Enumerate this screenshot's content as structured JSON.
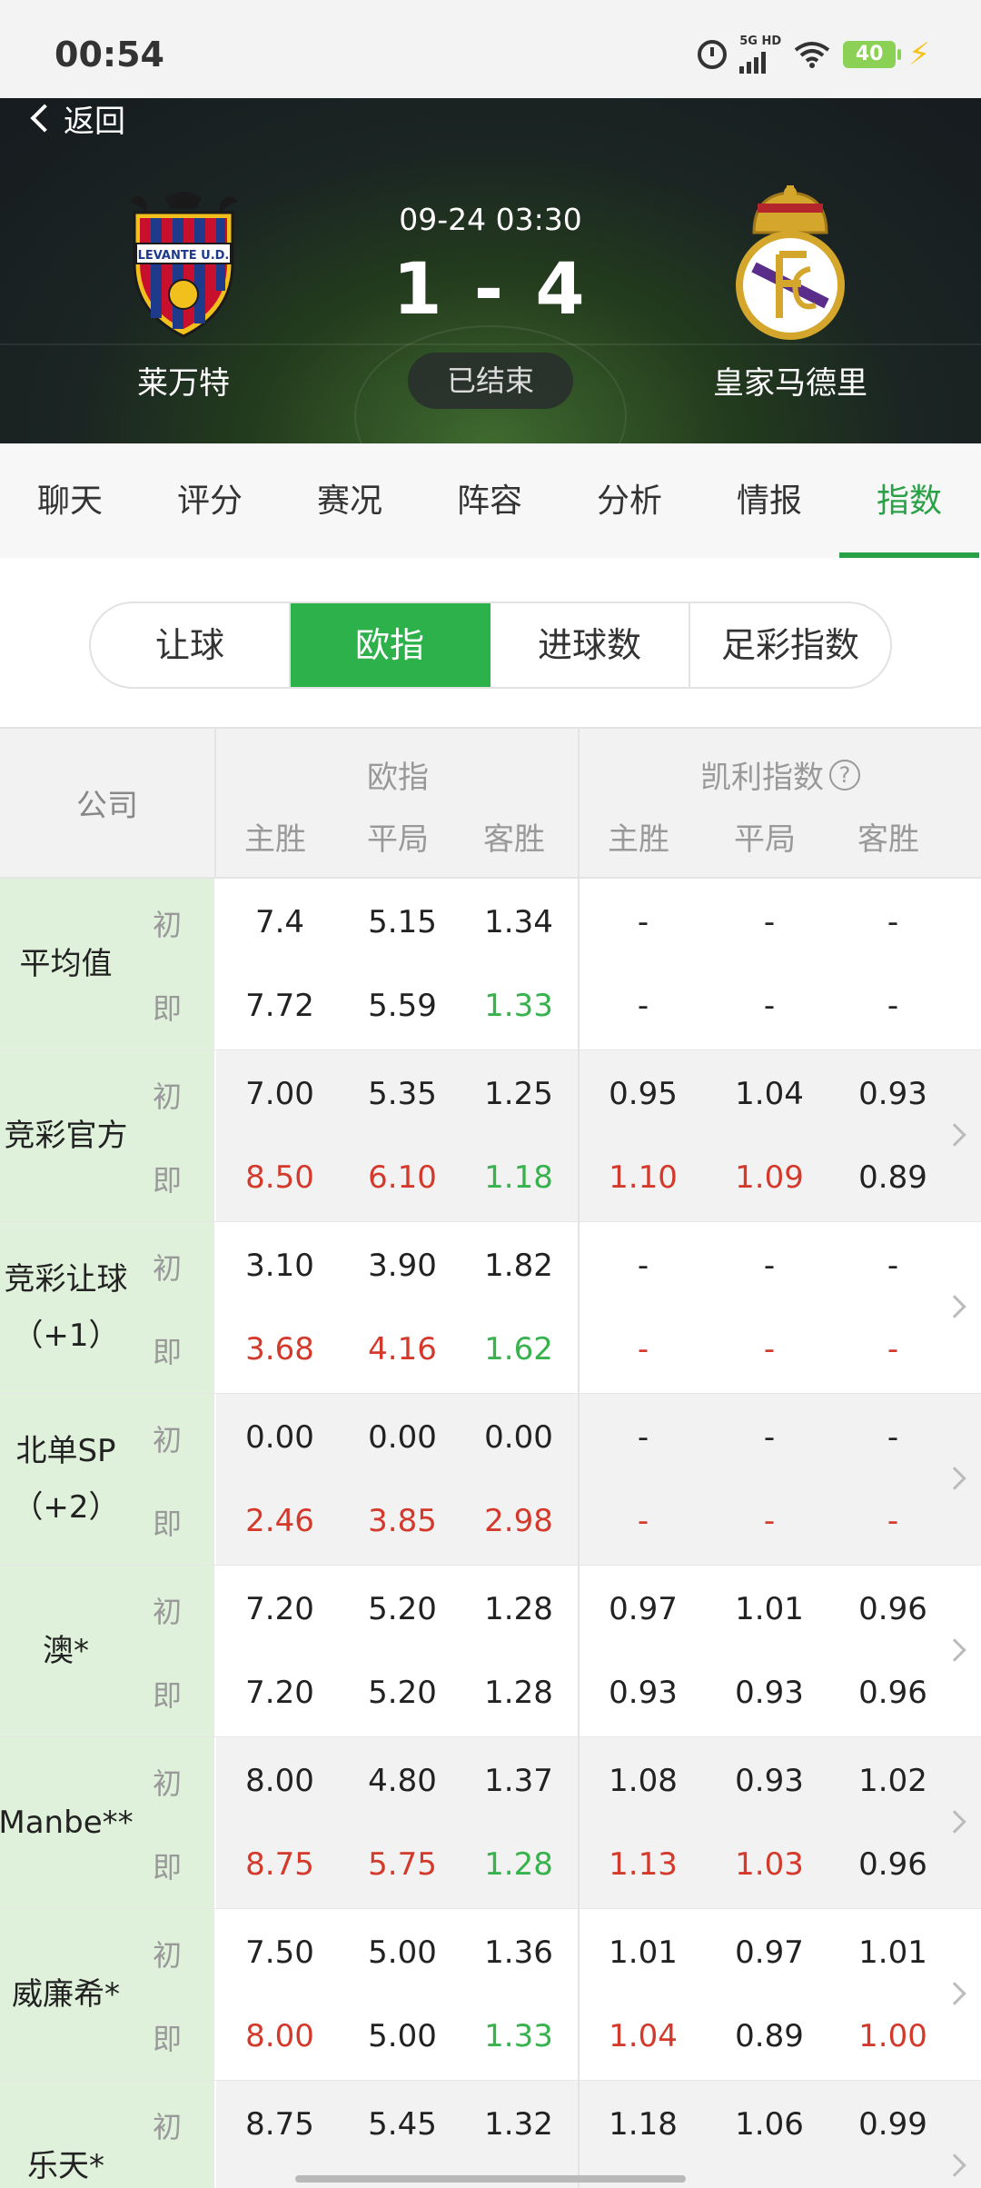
{
  "status_bar": {
    "time": "00:54",
    "network": "5G HD",
    "battery": "40"
  },
  "header": {
    "back_label": "返回",
    "match_time": "09-24 03:30",
    "score": "1 - 4",
    "status": "已结束",
    "home_team": "莱万特",
    "away_team": "皇家马德里",
    "home_logo_text": "LEVANTE U.D."
  },
  "main_tabs": [
    {
      "label": "聊天"
    },
    {
      "label": "评分"
    },
    {
      "label": "赛况"
    },
    {
      "label": "阵容"
    },
    {
      "label": "分析"
    },
    {
      "label": "情报"
    },
    {
      "label": "指数",
      "active": true
    }
  ],
  "sub_tabs": [
    {
      "label": "让球"
    },
    {
      "label": "欧指",
      "active": true
    },
    {
      "label": "进球数"
    },
    {
      "label": "足彩指数"
    }
  ],
  "table": {
    "company_header": "公司",
    "euro_header": "欧指",
    "kelly_header": "凯利指数",
    "help_icon": "?",
    "columns": [
      "主胜",
      "平局",
      "客胜",
      "主胜",
      "平局",
      "客胜"
    ],
    "init_tag": "初",
    "live_tag": "即",
    "colors": {
      "up": "#d33a2c",
      "down": "#37b24d",
      "accent": "#2aa147"
    },
    "rows": [
      {
        "name": "平均值",
        "name2": "",
        "has_detail": false,
        "init": [
          "7.4",
          "5.15",
          "1.34",
          "-",
          "-",
          "-"
        ],
        "live": [
          "7.72",
          "5.59",
          "1.33",
          "-",
          "-",
          "-"
        ],
        "live_trend": [
          "",
          "",
          "down",
          "",
          "",
          ""
        ]
      },
      {
        "name": "竞彩官方",
        "name2": "",
        "has_detail": true,
        "init": [
          "7.00",
          "5.35",
          "1.25",
          "0.95",
          "1.04",
          "0.93"
        ],
        "live": [
          "8.50",
          "6.10",
          "1.18",
          "1.10",
          "1.09",
          "0.89"
        ],
        "live_trend": [
          "up",
          "up",
          "down",
          "up",
          "up",
          ""
        ]
      },
      {
        "name": "竞彩让球",
        "name2": "（+1）",
        "has_detail": true,
        "init": [
          "3.10",
          "3.90",
          "1.82",
          "-",
          "-",
          "-"
        ],
        "live": [
          "3.68",
          "4.16",
          "1.62",
          "-",
          "-",
          "-"
        ],
        "live_trend": [
          "up",
          "up",
          "down",
          "up",
          "up",
          "up"
        ]
      },
      {
        "name": "北单SP",
        "name2": "（+2）",
        "has_detail": true,
        "init": [
          "0.00",
          "0.00",
          "0.00",
          "-",
          "-",
          "-"
        ],
        "live": [
          "2.46",
          "3.85",
          "2.98",
          "-",
          "-",
          "-"
        ],
        "live_trend": [
          "up",
          "up",
          "up",
          "up",
          "up",
          "up"
        ]
      },
      {
        "name": "澳*",
        "name2": "",
        "has_detail": true,
        "init": [
          "7.20",
          "5.20",
          "1.28",
          "0.97",
          "1.01",
          "0.96"
        ],
        "live": [
          "7.20",
          "5.20",
          "1.28",
          "0.93",
          "0.93",
          "0.96"
        ],
        "live_trend": [
          "",
          "",
          "",
          "",
          "",
          ""
        ]
      },
      {
        "name": "Manbe**",
        "name2": "",
        "has_detail": true,
        "init": [
          "8.00",
          "4.80",
          "1.37",
          "1.08",
          "0.93",
          "1.02"
        ],
        "live": [
          "8.75",
          "5.75",
          "1.28",
          "1.13",
          "1.03",
          "0.96"
        ],
        "live_trend": [
          "up",
          "up",
          "down",
          "up",
          "up",
          ""
        ]
      },
      {
        "name": "威廉希*",
        "name2": "",
        "has_detail": true,
        "init": [
          "7.50",
          "5.00",
          "1.36",
          "1.01",
          "0.97",
          "1.01"
        ],
        "live": [
          "8.00",
          "5.00",
          "1.33",
          "1.04",
          "0.89",
          "1.00"
        ],
        "live_trend": [
          "up",
          "",
          "down",
          "up",
          "",
          "up"
        ]
      },
      {
        "name": "乐天*",
        "name2": "",
        "has_detail": true,
        "init": [
          "8.75",
          "5.45",
          "1.32",
          "1.18",
          "1.06",
          "0.99"
        ],
        "live": [],
        "live_trend": []
      }
    ]
  }
}
